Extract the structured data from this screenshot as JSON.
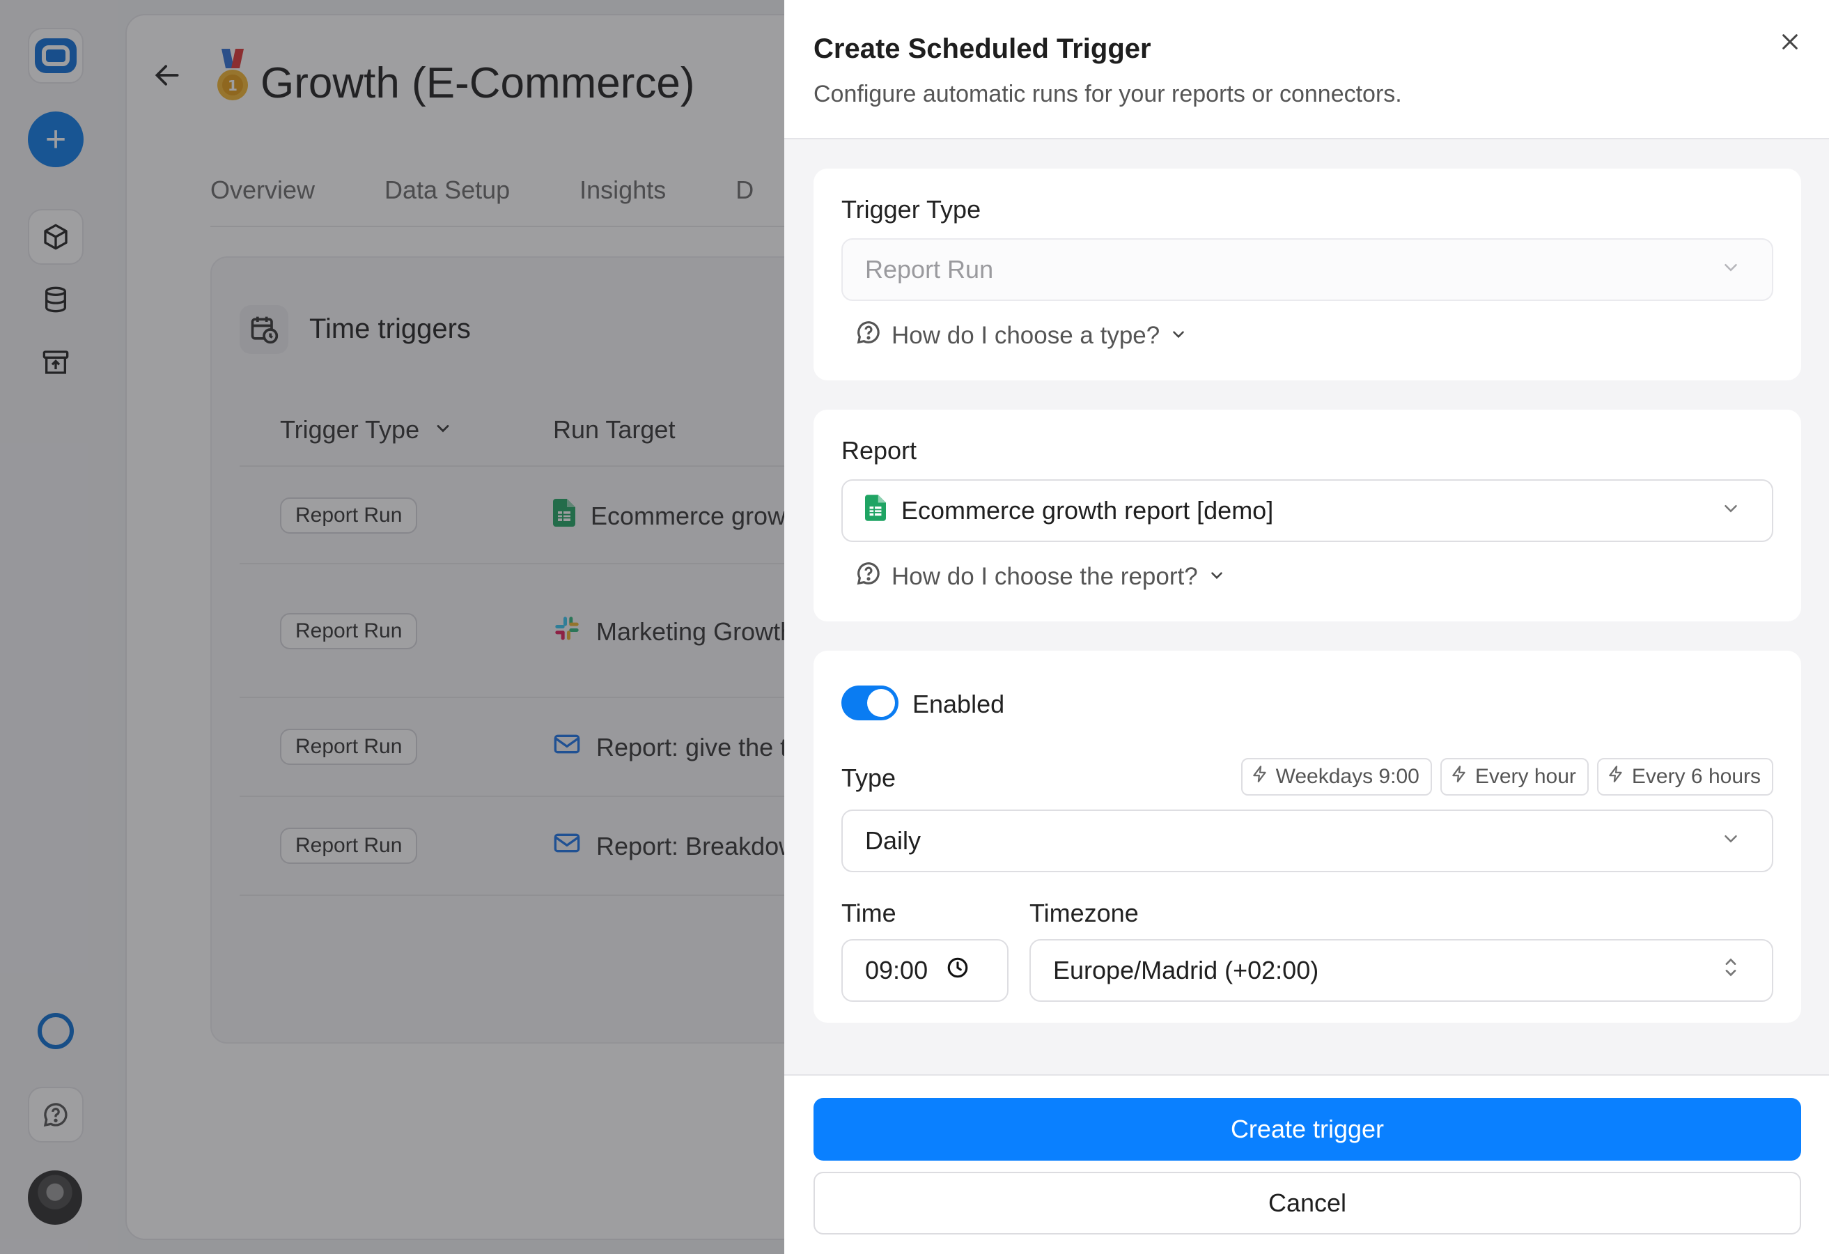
{
  "rail": {
    "icons": [
      "logo-icon",
      "plus-icon",
      "cube-icon",
      "database-icon",
      "archive-icon",
      "ring-icon",
      "help-chat-icon",
      "avatar"
    ]
  },
  "page": {
    "title": "Growth (E-Commerce)",
    "tabs": [
      "Overview",
      "Data Setup",
      "Insights",
      "D"
    ]
  },
  "triggers_card": {
    "title": "Time triggers",
    "columns": [
      "Trigger Type",
      "Run Target"
    ],
    "rows": [
      {
        "type": "Report Run",
        "target": "Ecommerce grow",
        "icon": "sheets-icon"
      },
      {
        "type": "Report Run",
        "target": "Marketing Growth",
        "icon": "slack-icon"
      },
      {
        "type": "Report Run",
        "target": "Report: give the t",
        "icon": "mail-icon"
      },
      {
        "type": "Report Run",
        "target": "Report: Breakdow",
        "icon": "mail-icon"
      }
    ]
  },
  "drawer": {
    "title": "Create Scheduled Trigger",
    "subtitle": "Configure automatic runs for your reports or connectors.",
    "trigger_type": {
      "label": "Trigger Type",
      "value": "Report Run",
      "help": "How do I choose a type?"
    },
    "report": {
      "label": "Report",
      "value": "Ecommerce growth report [demo]",
      "help": "How do I choose the report?"
    },
    "schedule": {
      "enabled_label": "Enabled",
      "enabled": true,
      "type_label": "Type",
      "presets": [
        "Weekdays 9:00",
        "Every hour",
        "Every 6 hours"
      ],
      "type_value": "Daily",
      "time_label": "Time",
      "time_value": "09:00",
      "timezone_label": "Timezone",
      "timezone_value": "Europe/Madrid (+02:00)"
    },
    "buttons": {
      "create": "Create trigger",
      "cancel": "Cancel"
    }
  },
  "colors": {
    "accent": "#0a80ff",
    "toggle_on": "#0a7cf2",
    "overlay": "#28282d"
  }
}
